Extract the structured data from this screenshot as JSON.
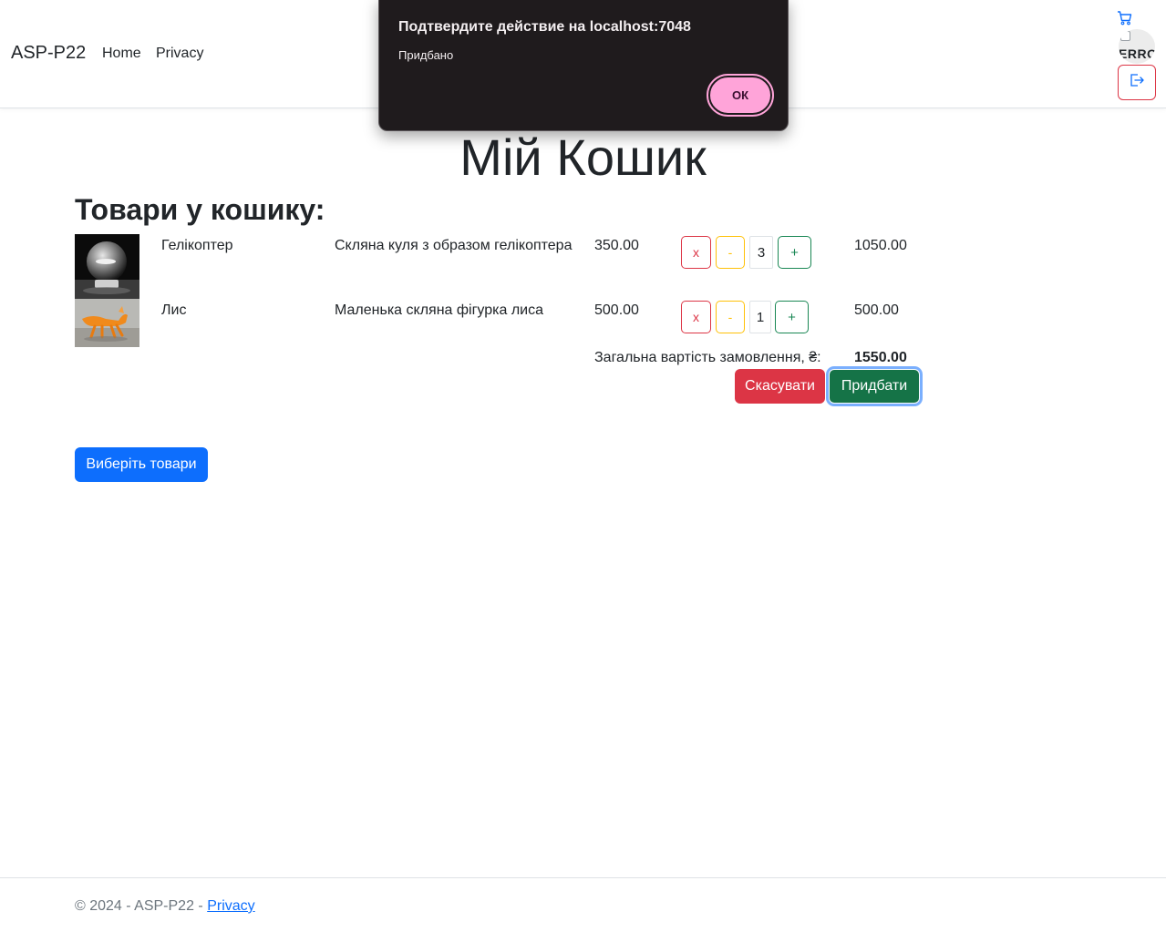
{
  "navbar": {
    "brand": "ASP-P22",
    "links": [
      "Home",
      "Privacy"
    ],
    "avatar_alt": "ERROR"
  },
  "dialog": {
    "title": "Подтвердите действие на localhost:7048",
    "message": "Придбано",
    "ok_label": "ОК"
  },
  "page": {
    "title": "Мій Кошик",
    "heading": "Товари у кошику:"
  },
  "cart": {
    "items": [
      {
        "name": "Гелікоптер",
        "description": "Скляна куля з образом гелікоптера",
        "price": "350.00",
        "quantity": "3",
        "total": "1050.00"
      },
      {
        "name": "Лис",
        "description": "Маленька скляна фігурка лиса",
        "price": "500.00",
        "quantity": "1",
        "total": "500.00"
      }
    ],
    "controls": {
      "delete": "x",
      "decrement": "-",
      "increment": "+"
    },
    "sum_label": "Загальна вартість замовлення, ₴:",
    "sum_value": "1550.00",
    "cancel_label": "Скасувати",
    "buy_label": "Придбати",
    "choose_label": "Виберіть товари"
  },
  "footer": {
    "prefix": "© 2024 - ASP-P22 - ",
    "privacy": "Privacy"
  },
  "colors": {
    "primary": "#0d6efd",
    "danger": "#dc3545",
    "warning": "#ffc107",
    "success": "#198754",
    "dialog_bg": "#1f1b1d",
    "dialog_button": "#ffa4d9"
  },
  "icons": [
    "cart-icon",
    "logout-icon",
    "broken-image-icon"
  ]
}
